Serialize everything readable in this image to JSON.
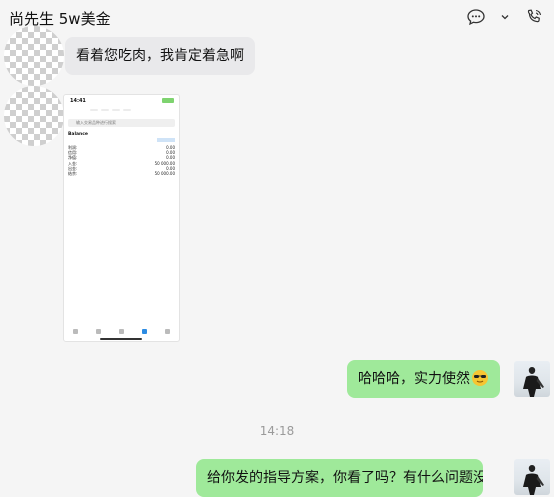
{
  "header": {
    "title": "尚先生 5w美金",
    "icons": [
      "chat-bubble-icon",
      "chevron-down-icon",
      "voice-call-icon"
    ]
  },
  "messages": [
    {
      "side": "in",
      "text": "看着您吃肉，我肯定着急啊"
    },
    {
      "side": "in",
      "type": "image"
    },
    {
      "side": "out",
      "text": "哈哈哈，实力使然"
    },
    {
      "side": "out",
      "text": "给你发的指导方案，你看了吗？有什么问题没"
    }
  ],
  "timestamp": "14:18",
  "screenshot": {
    "status_time": "14:41",
    "tabs": [
      "",
      "",
      "",
      ""
    ],
    "search_placeholder": "输入交易品种进行搜索",
    "balance_label": "Balance",
    "balance_date": "",
    "rows": [
      {
        "label": "利润:",
        "value": "0.00"
      },
      {
        "label": "信用:",
        "value": "0.00"
      },
      {
        "label": "净值:",
        "value": "0.00"
      },
      {
        "label": "入金:",
        "value": "50 000.00"
      },
      {
        "label": "出金:",
        "value": "0.00"
      },
      {
        "label": "结余:",
        "value": "50 000.00"
      }
    ]
  },
  "colors": {
    "outgoing_bubble": "#9fe99a",
    "incoming_bubble": "#e9e9eb",
    "background": "#f5f5f5"
  }
}
